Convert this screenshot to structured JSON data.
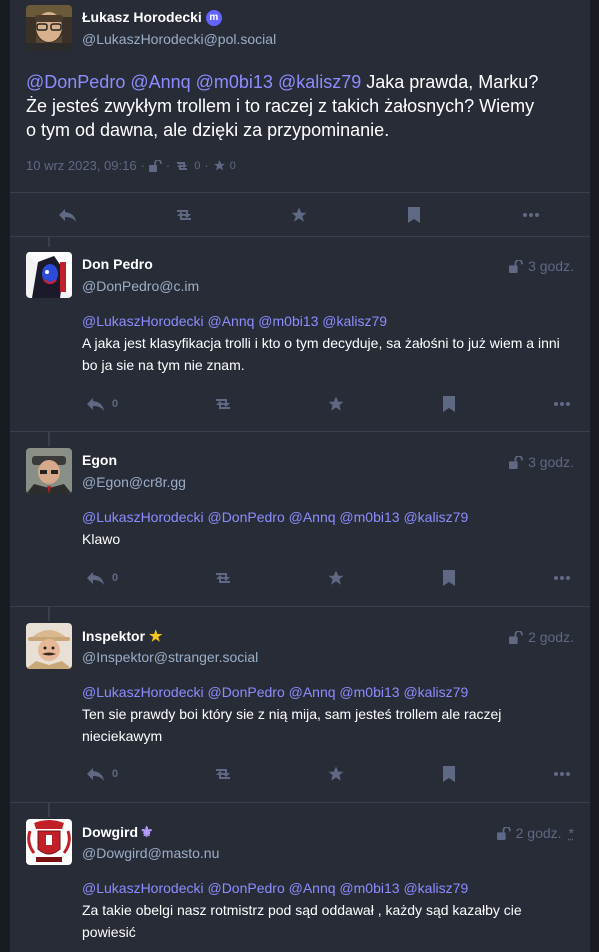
{
  "focused": {
    "display_name": "Łukasz Horodecki",
    "account": "@LukaszHorodecki@pol.social",
    "mentions": "@DonPedro @Annq @m0bi13 @kalisz79",
    "text_line1": " Jaka prawda, Marku?",
    "text_line2": "Że jesteś zwykłym trollem i to raczej z takich żałosnych?  Wiemy",
    "text_line3": "o tym od dawna, ale dzięki za przypominanie.",
    "date": "10 wrz 2023, 09:16",
    "separator": "·",
    "boosts": "0",
    "favourites": "0",
    "bot_icon": "mastodon-icon"
  },
  "replies": [
    {
      "display_name": "Don Pedro",
      "account": "@DonPedro@c.im",
      "time": "3 godz.",
      "mentions": "@LukaszHorodecki @Annq @m0bi13 @kalisz79",
      "text": "A jaka jest klasyfikacja trolli i kto o tym decyduje, sa żałośni to już wiem a inni bo ja sie na tym nie znam.",
      "replies_count": "0"
    },
    {
      "display_name": "Egon",
      "account": "@Egon@cr8r.gg",
      "time": "3 godz.",
      "mentions": "@LukaszHorodecki @DonPedro @Annq @m0bi13 @kalisz79",
      "text": "Klawo",
      "replies_count": "0"
    },
    {
      "display_name": "Inspektor",
      "account": "@Inspektor@stranger.social",
      "time": "2 godz.",
      "mentions": "@LukaszHorodecki @DonPedro @Annq @m0bi13 @kalisz79",
      "text": "Ten sie prawdy boi który sie z nią mija, sam jesteś trollem ale raczej nieciekawym",
      "replies_count": "0",
      "badge": "★"
    },
    {
      "display_name": "Dowgird",
      "account": "@Dowgird@masto.nu",
      "time": "2 godz.",
      "edited_marker": "*",
      "mentions": "@LukaszHorodecki @DonPedro @Annq @m0bi13 @kalisz79",
      "text": "Za takie obelgi nasz rotmistrz pod sąd oddawał , każdy sąd kazałby cie powiesić",
      "badge": "⚜"
    }
  ],
  "colors": {
    "background": "#191b22",
    "column": "#282c37",
    "mention": "#8c8dff",
    "muted": "#606984",
    "account": "#9baec8"
  }
}
